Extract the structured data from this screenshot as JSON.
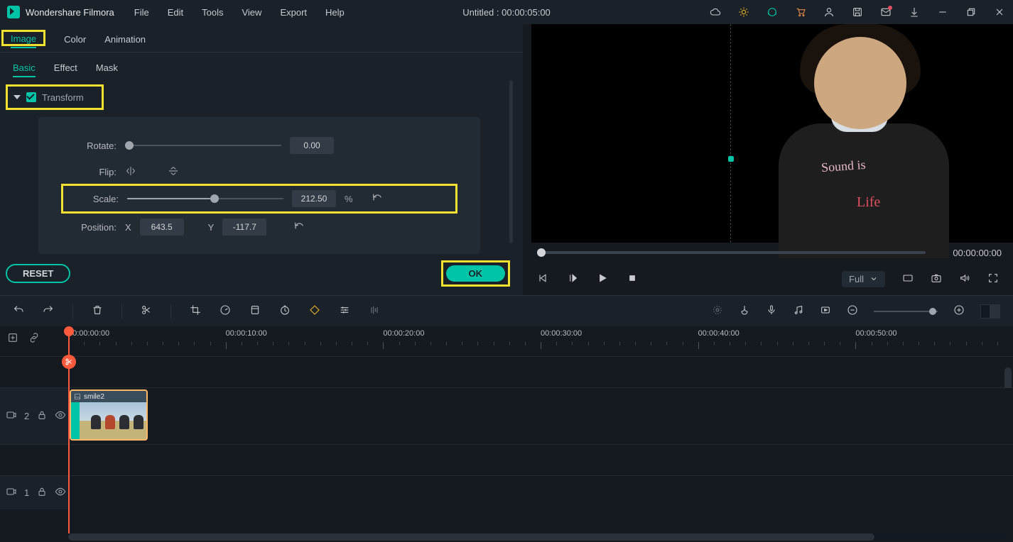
{
  "app": {
    "name": "Wondershare Filmora"
  },
  "menu": {
    "file": "File",
    "edit": "Edit",
    "tools": "Tools",
    "view": "View",
    "export": "Export",
    "help": "Help"
  },
  "document": {
    "title": "Untitled : 00:00:05:00"
  },
  "inspector": {
    "tabs1": {
      "image": "Image",
      "color": "Color",
      "animation": "Animation",
      "active": "Image"
    },
    "tabs2": {
      "basic": "Basic",
      "effect": "Effect",
      "mask": "Mask",
      "active": "Basic"
    },
    "transform": {
      "heading": "Transform",
      "rotate": {
        "label": "Rotate:",
        "value": "0.00",
        "pos_pct": 0
      },
      "flip": {
        "label": "Flip:"
      },
      "scale": {
        "label": "Scale:",
        "value": "212.50",
        "unit": "%",
        "pos_pct": 53
      },
      "position": {
        "label": "Position:",
        "x_label": "X",
        "x": "643.5",
        "y_label": "Y",
        "y": "-117.7"
      }
    },
    "buttons": {
      "reset": "RESET",
      "ok": "OK"
    }
  },
  "preview": {
    "timecode": "00:00:00:00",
    "view_mode": "Full",
    "sound_text": "Sound is",
    "life_text": "Life"
  },
  "ruler": {
    "labels": [
      "00:00:00:00",
      "00:00:10:00",
      "00:00:20:00",
      "00:00:30:00",
      "00:00:40:00",
      "00:00:50:00"
    ]
  },
  "tracks": {
    "v2": {
      "label": "2"
    },
    "v1": {
      "label": "1"
    }
  },
  "clip": {
    "name": "smile2"
  }
}
